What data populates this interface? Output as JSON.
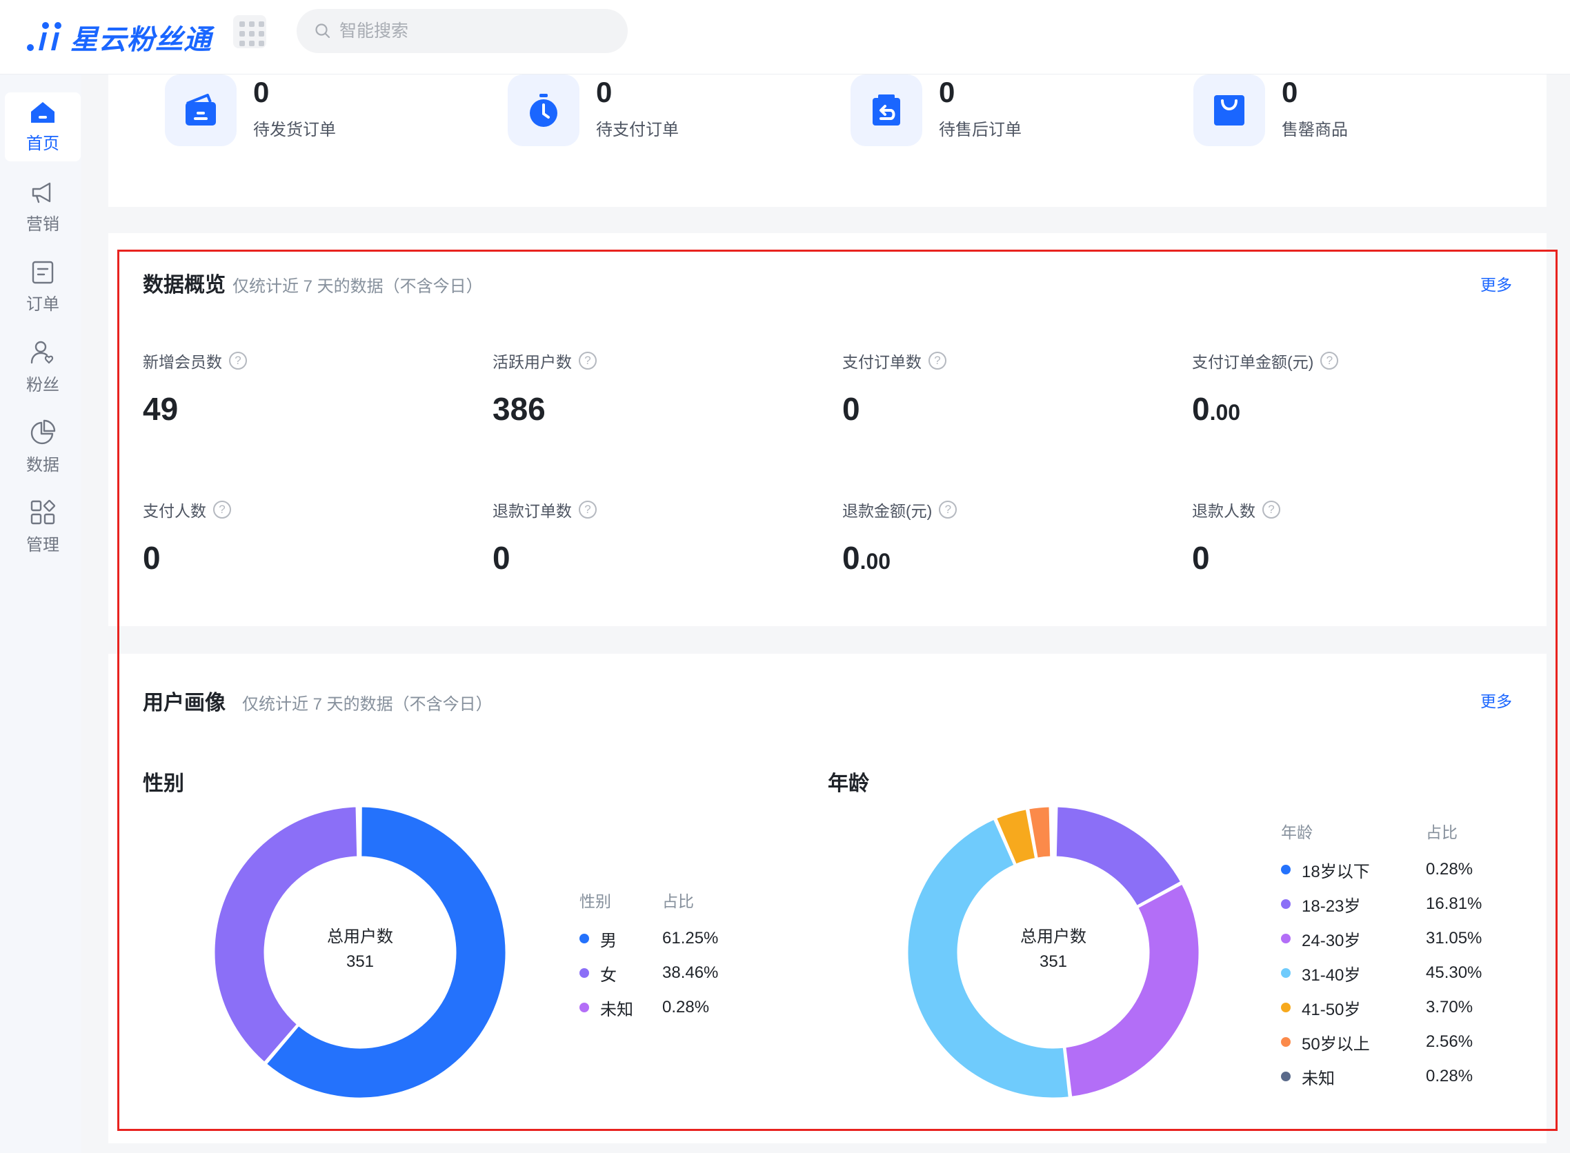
{
  "header": {
    "logo_text": "星云粉丝通",
    "search_placeholder": "智能搜索"
  },
  "sidebar": {
    "items": [
      {
        "label": "首页",
        "icon": "home-icon",
        "active": true
      },
      {
        "label": "营销",
        "icon": "megaphone-icon",
        "active": false
      },
      {
        "label": "订单",
        "icon": "order-icon",
        "active": false
      },
      {
        "label": "粉丝",
        "icon": "fans-icon",
        "active": false
      },
      {
        "label": "数据",
        "icon": "pie-chart-icon",
        "active": false
      },
      {
        "label": "管理",
        "icon": "grid-manage-icon",
        "active": false
      }
    ]
  },
  "top_stats": [
    {
      "value": "0",
      "label": "待发货订单",
      "icon": "wallet-icon"
    },
    {
      "value": "0",
      "label": "待支付订单",
      "icon": "stopwatch-icon"
    },
    {
      "value": "0",
      "label": "待售后订单",
      "icon": "return-icon"
    },
    {
      "value": "0",
      "label": "售罄商品",
      "icon": "shopping-bag-icon"
    }
  ],
  "overview": {
    "title": "数据概览",
    "subtitle": "仅统计近 7 天的数据（不含今日）",
    "more": "更多",
    "metrics": [
      {
        "label": "新增会员数",
        "int": "49",
        "dec": ""
      },
      {
        "label": "活跃用户数",
        "int": "386",
        "dec": ""
      },
      {
        "label": "支付订单数",
        "int": "0",
        "dec": ""
      },
      {
        "label": "支付订单金额(元)",
        "int": "0",
        "dec": ".00"
      },
      {
        "label": "支付人数",
        "int": "0",
        "dec": ""
      },
      {
        "label": "退款订单数",
        "int": "0",
        "dec": ""
      },
      {
        "label": "退款金额(元)",
        "int": "0",
        "dec": ".00"
      },
      {
        "label": "退款人数",
        "int": "0",
        "dec": ""
      }
    ],
    "help_glyph": "?"
  },
  "portrait": {
    "title": "用户画像",
    "subtitle": "仅统计近 7 天的数据（不含今日）",
    "more": "更多",
    "gender_label": "性别",
    "age_label": "年龄",
    "center_label": "总用户数",
    "center_value": "351"
  },
  "chart_data": [
    {
      "type": "pie",
      "title": "性别",
      "legend_headers": [
        "性别",
        "占比"
      ],
      "categories": [
        "男",
        "女",
        "未知"
      ],
      "values": [
        61.25,
        38.46,
        0.28
      ],
      "labels": [
        "61.25%",
        "38.46%",
        "0.28%"
      ],
      "colors": [
        "#2472fc",
        "#8b6ff7",
        "#b36ef7"
      ],
      "donut": true
    },
    {
      "type": "pie",
      "title": "年龄",
      "legend_headers": [
        "年龄",
        "占比"
      ],
      "categories": [
        "18岁以下",
        "18-23岁",
        "24-30岁",
        "31-40岁",
        "41-50岁",
        "50岁以上",
        "未知"
      ],
      "values": [
        0.28,
        16.81,
        31.05,
        45.3,
        3.7,
        2.56,
        0.28
      ],
      "labels": [
        "0.28%",
        "16.81%",
        "31.05%",
        "45.30%",
        "3.70%",
        "2.56%",
        "0.28%"
      ],
      "colors": [
        "#2472fc",
        "#8b6ff7",
        "#b36ef7",
        "#6fcbfc",
        "#f7a91d",
        "#fb8a4a",
        "#5a6a8a"
      ],
      "donut": true
    }
  ]
}
